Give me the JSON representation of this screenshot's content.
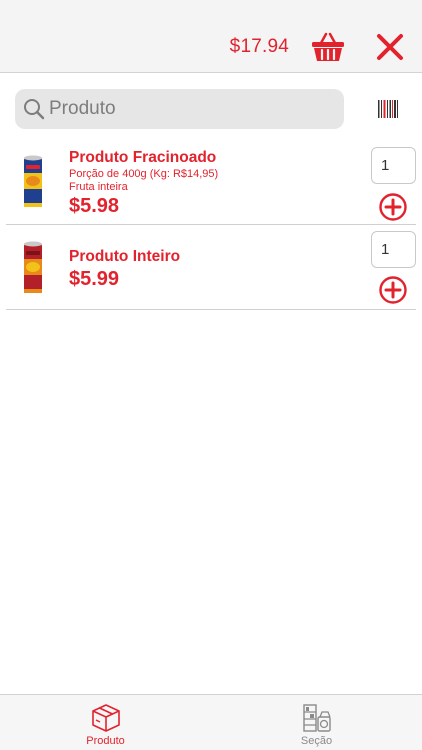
{
  "header": {
    "total": "$17.94",
    "cart_icon": "basket-icon",
    "close_icon": "close-icon",
    "accent_color": "#e2232e"
  },
  "search": {
    "placeholder": "Produto",
    "value": "",
    "icon": "search-icon",
    "barcode_icon": "barcode-icon"
  },
  "products": [
    {
      "name": "Produto Fracinoado",
      "detail": "Porção de 400g (Kg: R$14,95)",
      "note": "Fruta inteira",
      "price": "$5.98",
      "quantity": "1",
      "image": "chips-can-yellow"
    },
    {
      "name": "Produto Inteiro",
      "price": "$5.99",
      "quantity": "1",
      "image": "chips-can-red"
    }
  ],
  "tabs": [
    {
      "label": "Produto",
      "icon": "box-icon",
      "active": true
    },
    {
      "label": "Seção",
      "icon": "section-icon",
      "active": false
    }
  ]
}
